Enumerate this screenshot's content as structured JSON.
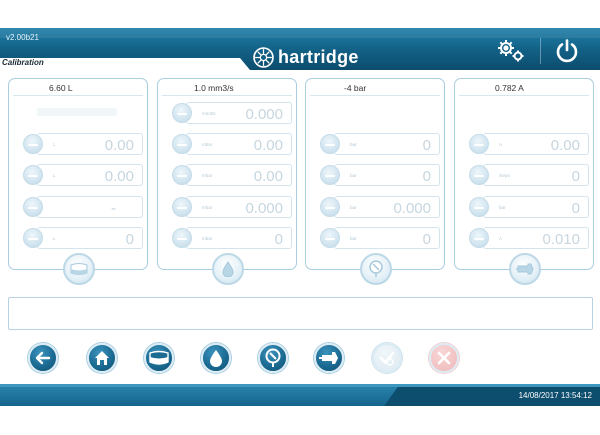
{
  "app": {
    "version": "v2.00b21",
    "brand": "hartridge",
    "screen_title": "Calibration",
    "datetime": "14/08/2017 13:54:12"
  },
  "header": {
    "settings_icon": "gears-icon",
    "power_icon": "power-icon"
  },
  "panels": [
    {
      "heading": "6.60 L",
      "foot_icon": "tank-icon",
      "rows": [
        {
          "unit": "",
          "value": ""
        },
        {
          "unit": "L",
          "value": "0.00"
        },
        {
          "unit": "L",
          "value": "0.00"
        },
        {
          "unit": "",
          "value": "-"
        },
        {
          "unit": "L",
          "value": "0"
        }
      ]
    },
    {
      "heading": "1.0 mm3/s",
      "foot_icon": "drop-icon",
      "rows": [
        {
          "unit": "mm3/s",
          "value": "0.000"
        },
        {
          "unit": "mbar",
          "value": "0.00"
        },
        {
          "unit": "mbar",
          "value": "0.00"
        },
        {
          "unit": "mbar",
          "value": "0.000"
        },
        {
          "unit": "mbar",
          "value": "0"
        }
      ]
    },
    {
      "heading": "-4 bar",
      "foot_icon": "gauge-icon",
      "rows": [
        {
          "unit": "",
          "value": ""
        },
        {
          "unit": "bar",
          "value": "0"
        },
        {
          "unit": "bar",
          "value": "0"
        },
        {
          "unit": "bar",
          "value": "0.000"
        },
        {
          "unit": "bar",
          "value": "0"
        }
      ]
    },
    {
      "heading": "0.782 A",
      "foot_icon": "motor-icon",
      "rows": [
        {
          "unit": "",
          "value": ""
        },
        {
          "unit": "A",
          "value": "0.00"
        },
        {
          "unit": "steps",
          "value": "0"
        },
        {
          "unit": "bar",
          "value": "0"
        },
        {
          "unit": "A",
          "value": "0.010"
        }
      ]
    }
  ],
  "message": "",
  "nav": [
    {
      "name": "back",
      "icon": "arrow-left-icon"
    },
    {
      "name": "home",
      "icon": "home-icon"
    },
    {
      "name": "tank",
      "icon": "tank-icon"
    },
    {
      "name": "flow",
      "icon": "drop-icon"
    },
    {
      "name": "pressure",
      "icon": "gauge-icon"
    },
    {
      "name": "motor",
      "icon": "motor-icon"
    },
    {
      "name": "accept",
      "icon": "check-icon"
    },
    {
      "name": "cancel",
      "icon": "close-icon"
    }
  ],
  "colors": {
    "header": "#125f84",
    "panel_border": "#a9cde1",
    "button": "#1b6b93",
    "cancel": "#efb7b7"
  }
}
